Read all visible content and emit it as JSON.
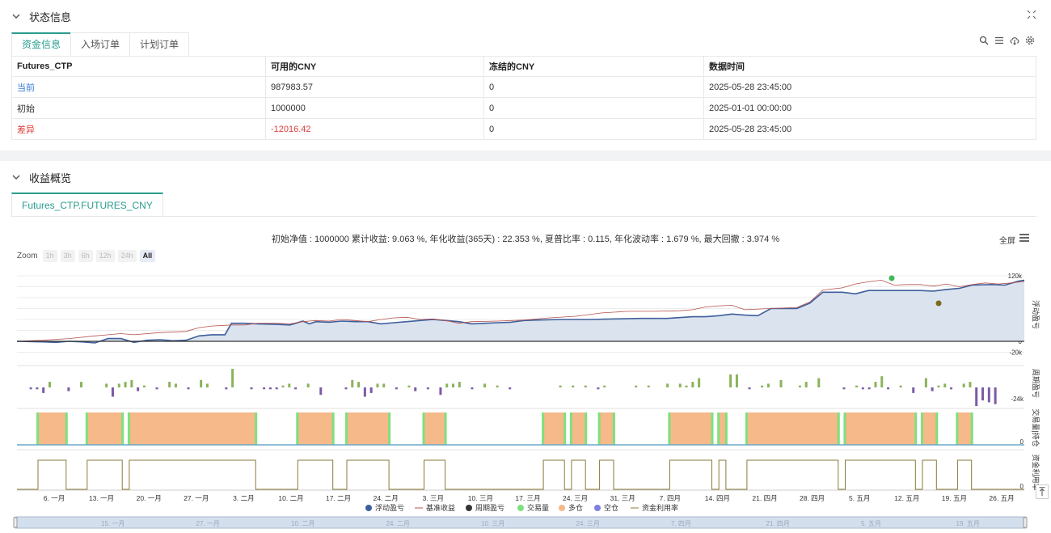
{
  "status_panel": {
    "title": "状态信息",
    "tabs": [
      "资金信息",
      "入场订单",
      "计划订单"
    ],
    "table": {
      "headers": [
        "Futures_CTP",
        "可用的CNY",
        "冻结的CNY",
        "数据时间"
      ],
      "rows": [
        {
          "label": "当前",
          "available": "987983.57",
          "frozen": "0",
          "time": "2025-05-28 23:45:00"
        },
        {
          "label": "初始",
          "available": "1000000",
          "frozen": "0",
          "time": "2025-01-01 00:00:00"
        },
        {
          "label": "差异",
          "available": "-12016.42",
          "frozen": "0",
          "time": "2025-05-28 23:45:00"
        }
      ]
    }
  },
  "profit_panel": {
    "title": "收益概览",
    "subtab": "Futures_CTP.FUTURES_CNY",
    "summary": "初始净值 : 1000000 累计收益: 9.063 %, 年化收益(365天) : 22.353 %, 夏普比率 : 0.115, 年化波动率 : 1.679 %, 最大回撤 : 3.974 %",
    "fullscreen_label": "全屏",
    "zoom": {
      "label": "Zoom",
      "buttons": [
        "1h",
        "3h",
        "6h",
        "12h",
        "24h",
        "All"
      ],
      "active": "All"
    }
  },
  "colors": {
    "accent": "#2a9d8f",
    "float_pnl": "#3d5f9b",
    "benchmark": "#b5514f",
    "period_pos": "#8ab35a",
    "period_neg": "#7b5ba6",
    "long": "#f6b98a",
    "trade": "#7ee07e",
    "utilization": "#8a7a3a",
    "short": "#8080e0"
  },
  "chart_data": {
    "type": "line",
    "x_ticks": [
      "6. 一月",
      "13. 一月",
      "20. 一月",
      "27. 一月",
      "3. 二月",
      "10. 二月",
      "17. 二月",
      "24. 二月",
      "3. 三月",
      "10. 三月",
      "17. 三月",
      "24. 三月",
      "31. 三月",
      "7. 四月",
      "14. 四月",
      "21. 四月",
      "28. 四月",
      "5. 五月",
      "12. 五月",
      "19. 五月",
      "26. 五月"
    ],
    "navigator_ticks": [
      "15. 一月",
      "27. 一月",
      "10. 二月",
      "24. 二月",
      "10. 三月",
      "24. 三月",
      "7. 四月",
      "21. 四月",
      "5. 五月",
      "19. 五月"
    ],
    "panes": [
      {
        "name": "浮动盈亏",
        "y_ticks": [
          "120k",
          "100k",
          "80k",
          "60k",
          "40k",
          "20k",
          "0",
          "-20k"
        ],
        "ylim": [
          -20000,
          120000
        ]
      },
      {
        "name": "周期盈亏",
        "y_ticks": [
          "-24k"
        ]
      },
      {
        "name": "交易量|持仓",
        "y_ticks": [
          "0"
        ]
      },
      {
        "name": "资金利用率",
        "y_ticks": [
          "0"
        ]
      }
    ],
    "legend": [
      "浮动盈亏",
      "基准收益",
      "周期盈亏",
      "交易量",
      "多仓",
      "空仓",
      "资金利用率"
    ],
    "series": [
      {
        "name": "浮动盈亏",
        "values": [
          [
            0,
            0
          ],
          [
            4,
            -1000
          ],
          [
            6,
            -2000
          ],
          [
            8,
            0
          ],
          [
            10,
            -1000
          ],
          [
            12,
            -3000
          ],
          [
            14,
            5000
          ],
          [
            16,
            5000
          ],
          [
            18,
            -2000
          ],
          [
            20,
            2000
          ],
          [
            22,
            3000
          ],
          [
            24,
            1000
          ],
          [
            26,
            2000
          ],
          [
            28,
            10000
          ],
          [
            30,
            12000
          ],
          [
            32,
            12000
          ],
          [
            33,
            33000
          ],
          [
            35,
            33000
          ],
          [
            37,
            32000
          ],
          [
            40,
            31000
          ],
          [
            42,
            30000
          ],
          [
            44,
            37000
          ],
          [
            45,
            32000
          ],
          [
            46,
            36000
          ],
          [
            48,
            35000
          ],
          [
            50,
            37000
          ],
          [
            52,
            36000
          ],
          [
            54,
            36000
          ],
          [
            56,
            32000
          ],
          [
            58,
            34000
          ],
          [
            60,
            36000
          ],
          [
            62,
            38000
          ],
          [
            64,
            40000
          ],
          [
            66,
            38000
          ],
          [
            68,
            36000
          ],
          [
            70,
            32000
          ],
          [
            72,
            33000
          ],
          [
            74,
            34000
          ],
          [
            76,
            35000
          ],
          [
            78,
            38000
          ],
          [
            80,
            39000
          ],
          [
            84,
            40000
          ],
          [
            88,
            40000
          ],
          [
            92,
            41000
          ],
          [
            96,
            42000
          ],
          [
            100,
            42000
          ],
          [
            104,
            45000
          ],
          [
            106,
            45000
          ],
          [
            108,
            47000
          ],
          [
            110,
            50000
          ],
          [
            112,
            48000
          ],
          [
            114,
            47000
          ],
          [
            116,
            60000
          ],
          [
            120,
            60000
          ],
          [
            122,
            70000
          ],
          [
            124,
            90000
          ],
          [
            127,
            90000
          ],
          [
            129,
            87000
          ],
          [
            131,
            93000
          ],
          [
            133,
            93000
          ],
          [
            137,
            93000
          ],
          [
            139,
            93000
          ],
          [
            141,
            92000
          ],
          [
            143,
            95000
          ],
          [
            145,
            97000
          ],
          [
            147,
            103000
          ],
          [
            150,
            104000
          ],
          [
            152,
            103000
          ],
          [
            154,
            110000
          ],
          [
            155,
            112000
          ]
        ]
      },
      {
        "name": "基准收益",
        "values": [
          [
            0,
            0
          ],
          [
            4,
            2000
          ],
          [
            8,
            5000
          ],
          [
            12,
            10000
          ],
          [
            14,
            12000
          ],
          [
            16,
            14000
          ],
          [
            18,
            12000
          ],
          [
            22,
            16000
          ],
          [
            26,
            18000
          ],
          [
            28,
            25000
          ],
          [
            30,
            28000
          ],
          [
            33,
            30000
          ],
          [
            35,
            30000
          ],
          [
            37,
            33000
          ],
          [
            40,
            33000
          ],
          [
            42,
            32000
          ],
          [
            44,
            36000
          ],
          [
            46,
            38000
          ],
          [
            48,
            37000
          ],
          [
            50,
            40000
          ],
          [
            52,
            38000
          ],
          [
            54,
            36000
          ],
          [
            56,
            40000
          ],
          [
            58,
            43000
          ],
          [
            60,
            44000
          ],
          [
            62,
            40000
          ],
          [
            64,
            41000
          ],
          [
            66,
            38000
          ],
          [
            68,
            33000
          ],
          [
            70,
            36000
          ],
          [
            74,
            37000
          ],
          [
            78,
            39000
          ],
          [
            82,
            43000
          ],
          [
            86,
            46000
          ],
          [
            90,
            52000
          ],
          [
            94,
            55000
          ],
          [
            98,
            55000
          ],
          [
            102,
            56000
          ],
          [
            104,
            58000
          ],
          [
            106,
            63000
          ],
          [
            108,
            65000
          ],
          [
            110,
            66000
          ],
          [
            112,
            58000
          ],
          [
            116,
            60000
          ],
          [
            120,
            62000
          ],
          [
            122,
            72000
          ],
          [
            124,
            94000
          ],
          [
            127,
            98000
          ],
          [
            129,
            105000
          ],
          [
            131,
            109000
          ],
          [
            133,
            112000
          ],
          [
            135,
            103000
          ],
          [
            137,
            104000
          ],
          [
            139,
            104000
          ],
          [
            141,
            101000
          ],
          [
            143,
            105000
          ],
          [
            145,
            100000
          ],
          [
            147,
            104000
          ],
          [
            149,
            107000
          ],
          [
            151,
            105000
          ],
          [
            153,
            107000
          ],
          [
            155,
            110000
          ]
        ]
      }
    ]
  }
}
